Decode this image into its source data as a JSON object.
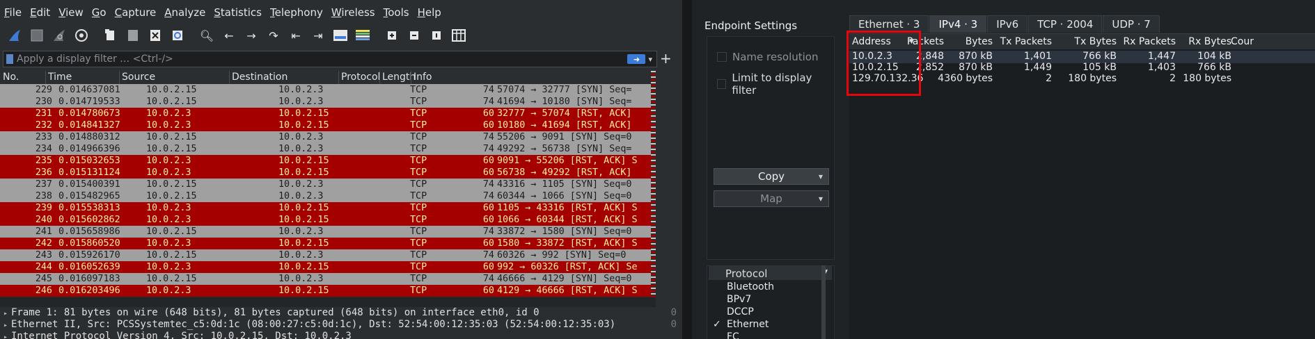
{
  "menu": [
    "File",
    "Edit",
    "View",
    "Go",
    "Capture",
    "Analyze",
    "Statistics",
    "Telephony",
    "Wireless",
    "Tools",
    "Help"
  ],
  "toolbar_icons": [
    "shark-fin-icon",
    "stop-icon",
    "restart-icon",
    "options-icon",
    "open-file-icon",
    "save-file-icon",
    "close-file-icon",
    "reload-icon",
    "find-icon",
    "back-icon",
    "forward-icon",
    "go-to-packet-icon",
    "first-packet-icon",
    "last-packet-icon",
    "autoscroll-icon",
    "colorize-icon",
    "zoom-in-icon",
    "zoom-out-icon",
    "normal-size-icon",
    "resize-columns-icon"
  ],
  "filter": {
    "placeholder": "Apply a display filter … <Ctrl-/>"
  },
  "packet_list": {
    "columns": [
      "No.",
      "Time",
      "Source",
      "Destination",
      "Protocol",
      "Length",
      "Info"
    ],
    "rows": [
      {
        "no": "229",
        "time": "0.014637081",
        "src": "10.0.2.15",
        "dst": "10.0.2.3",
        "proto": "TCP",
        "len": "74",
        "info": "57074 → 32777 [SYN] Seq=",
        "kind": "syn"
      },
      {
        "no": "230",
        "time": "0.014719533",
        "src": "10.0.2.15",
        "dst": "10.0.2.3",
        "proto": "TCP",
        "len": "74",
        "info": "41694 → 10180 [SYN] Seq=",
        "kind": "syn"
      },
      {
        "no": "231",
        "time": "0.014780673",
        "src": "10.0.2.3",
        "dst": "10.0.2.15",
        "proto": "TCP",
        "len": "60",
        "info": "32777 → 57074 [RST, ACK]",
        "kind": "rst"
      },
      {
        "no": "232",
        "time": "0.014841327",
        "src": "10.0.2.3",
        "dst": "10.0.2.15",
        "proto": "TCP",
        "len": "60",
        "info": "10180 → 41694 [RST, ACK]",
        "kind": "rst"
      },
      {
        "no": "233",
        "time": "0.014880312",
        "src": "10.0.2.15",
        "dst": "10.0.2.3",
        "proto": "TCP",
        "len": "74",
        "info": "55206 → 9091 [SYN] Seq=0",
        "kind": "syn"
      },
      {
        "no": "234",
        "time": "0.014966396",
        "src": "10.0.2.15",
        "dst": "10.0.2.3",
        "proto": "TCP",
        "len": "74",
        "info": "49292 → 56738 [SYN] Seq=",
        "kind": "syn"
      },
      {
        "no": "235",
        "time": "0.015032653",
        "src": "10.0.2.3",
        "dst": "10.0.2.15",
        "proto": "TCP",
        "len": "60",
        "info": "9091 → 55206 [RST, ACK] S",
        "kind": "rst"
      },
      {
        "no": "236",
        "time": "0.015131124",
        "src": "10.0.2.3",
        "dst": "10.0.2.15",
        "proto": "TCP",
        "len": "60",
        "info": "56738 → 49292 [RST, ACK]",
        "kind": "rst"
      },
      {
        "no": "237",
        "time": "0.015400391",
        "src": "10.0.2.15",
        "dst": "10.0.2.3",
        "proto": "TCP",
        "len": "74",
        "info": "43316 → 1105 [SYN] Seq=0",
        "kind": "syn"
      },
      {
        "no": "238",
        "time": "0.015482965",
        "src": "10.0.2.15",
        "dst": "10.0.2.3",
        "proto": "TCP",
        "len": "74",
        "info": "60344 → 1066 [SYN] Seq=0",
        "kind": "syn"
      },
      {
        "no": "239",
        "time": "0.015538313",
        "src": "10.0.2.3",
        "dst": "10.0.2.15",
        "proto": "TCP",
        "len": "60",
        "info": "1105 → 43316 [RST, ACK] S",
        "kind": "rst"
      },
      {
        "no": "240",
        "time": "0.015602862",
        "src": "10.0.2.3",
        "dst": "10.0.2.15",
        "proto": "TCP",
        "len": "60",
        "info": "1066 → 60344 [RST, ACK] S",
        "kind": "rst"
      },
      {
        "no": "241",
        "time": "0.015658986",
        "src": "10.0.2.15",
        "dst": "10.0.2.3",
        "proto": "TCP",
        "len": "74",
        "info": "33872 → 1580 [SYN] Seq=0",
        "kind": "syn"
      },
      {
        "no": "242",
        "time": "0.015860520",
        "src": "10.0.2.3",
        "dst": "10.0.2.15",
        "proto": "TCP",
        "len": "60",
        "info": "1580 → 33872 [RST, ACK] S",
        "kind": "rst"
      },
      {
        "no": "243",
        "time": "0.015926170",
        "src": "10.0.2.15",
        "dst": "10.0.2.3",
        "proto": "TCP",
        "len": "74",
        "info": "60326 → 992 [SYN] Seq=0 ",
        "kind": "syn"
      },
      {
        "no": "244",
        "time": "0.016052639",
        "src": "10.0.2.3",
        "dst": "10.0.2.15",
        "proto": "TCP",
        "len": "60",
        "info": "992 → 60326 [RST, ACK] Se",
        "kind": "rst"
      },
      {
        "no": "245",
        "time": "0.016097183",
        "src": "10.0.2.15",
        "dst": "10.0.2.3",
        "proto": "TCP",
        "len": "74",
        "info": "46666 → 4129 [SYN] Seq=0",
        "kind": "syn"
      },
      {
        "no": "246",
        "time": "0.016203496",
        "src": "10.0.2.3",
        "dst": "10.0.2.15",
        "proto": "TCP",
        "len": "60",
        "info": "4129 → 46666 [RST, ACK] S",
        "kind": "rst"
      }
    ]
  },
  "details": [
    {
      "text": "Frame 1: 81 bytes on wire (648 bits), 81 bytes captured (648 bits) on interface eth0, id 0",
      "num": "0"
    },
    {
      "text": "Ethernet II, Src: PCSSystemtec_c5:0d:1c (08:00:27:c5:0d:1c), Dst: 52:54:00:12:35:03 (52:54:00:12:35:03)",
      "num": "0"
    },
    {
      "text": "Internet Protocol Version 4, Src: 10.0.2.15, Dst: 10.0.2.3",
      "num": ""
    }
  ],
  "endpoints": {
    "title": "Endpoint Settings",
    "name_resolution": "Name resolution",
    "limit_filter": "Limit to display filter",
    "copy": "Copy",
    "map": "Map",
    "protocol_header": "Protocol",
    "protocols": [
      {
        "name": "Bluetooth",
        "checked": false
      },
      {
        "name": "BPv7",
        "checked": false
      },
      {
        "name": "DCCP",
        "checked": false
      },
      {
        "name": "Ethernet",
        "checked": true
      },
      {
        "name": "FC",
        "checked": false
      }
    ],
    "tabs": [
      "Ethernet · 3",
      "IPv4 · 3",
      "IPv6",
      "TCP · 2004",
      "UDP · 7"
    ],
    "active_tab": 1,
    "columns": [
      "Address",
      "Packets",
      "Bytes",
      "Tx Packets",
      "Tx Bytes",
      "Rx Packets",
      "Rx Bytes",
      "Cour"
    ],
    "rows": [
      {
        "address": "10.0.2.3",
        "packets": "2,848",
        "bytes": "870 kB",
        "tx_packets": "1,401",
        "tx_bytes": "766 kB",
        "rx_packets": "1,447",
        "rx_bytes": "104 kB"
      },
      {
        "address": "10.0.2.15",
        "packets": "2,852",
        "bytes": "870 kB",
        "tx_packets": "1,449",
        "tx_bytes": "105 kB",
        "rx_packets": "1,403",
        "rx_bytes": "766 kB"
      },
      {
        "address": "129.70.132.36",
        "packets": "4",
        "bytes": "360 bytes",
        "tx_packets": "2",
        "tx_bytes": "180 bytes",
        "rx_packets": "2",
        "rx_bytes": "180 bytes"
      }
    ]
  },
  "colors": {
    "syn_row": "#a0a0a0",
    "rst_row": "#a50000",
    "rst_text": "#ffee99",
    "highlight": "#e8060e"
  }
}
